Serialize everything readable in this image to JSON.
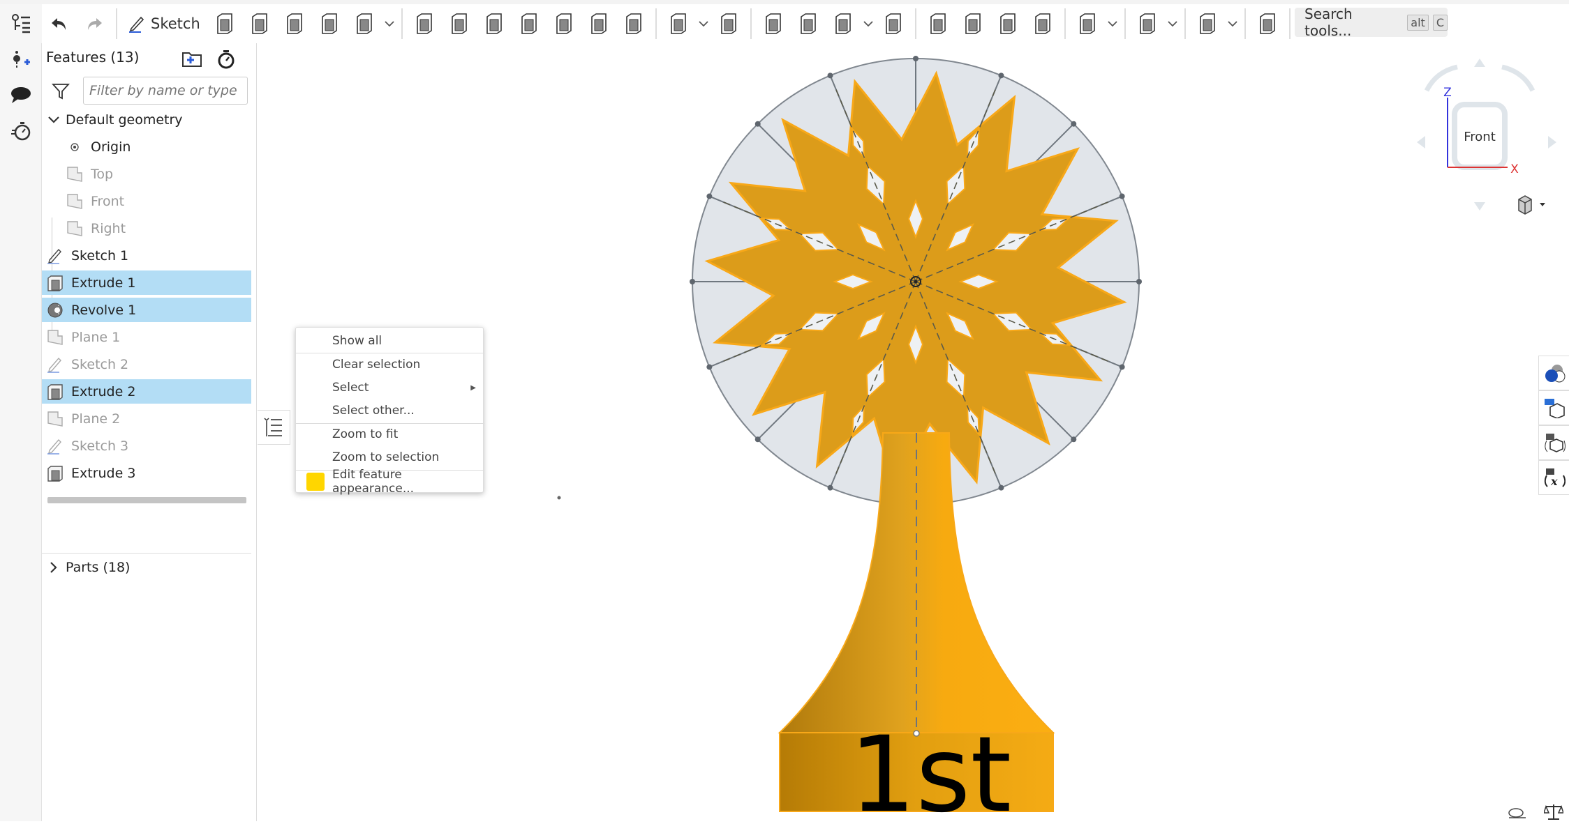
{
  "toolbar": {
    "sketch_label": "Sketch",
    "search_label": "Search tools...",
    "search_kbd": [
      "alt",
      "C"
    ],
    "groups": [
      [
        "extrude-icon",
        "revolve-icon",
        "sweep-icon",
        "loft-icon",
        "thicken-icon"
      ],
      [
        "fillet-icon",
        "chamfer-icon",
        "draft-icon",
        "rib-icon",
        "shell-icon",
        "hole-icon",
        "thread-icon"
      ],
      [
        "pattern-icon",
        "mirror-icon"
      ],
      [
        "boolean-icon",
        "split-icon",
        "transform-icon",
        "delete-part-icon"
      ],
      [
        "modify-fillet-icon",
        "delete-face-icon",
        "move-face-icon",
        "replace-face-icon"
      ],
      [
        "plane-icon"
      ],
      [
        "sheet-metal-icon"
      ],
      [
        "frame-icon"
      ],
      [
        "add-custom-feature-icon"
      ]
    ],
    "dropdown_after": [
      "thicken-icon",
      "pattern-icon",
      "transform-icon",
      "plane-icon",
      "sheet-metal-icon",
      "frame-icon"
    ]
  },
  "features": {
    "title": "Features (13)",
    "filter_placeholder": "Filter by name or type",
    "default_geometry": "Default geometry",
    "items": [
      {
        "label": "Origin",
        "icon": "origin-icon",
        "state": "normal",
        "child": true
      },
      {
        "label": "Top",
        "icon": "plane-icon",
        "state": "suppressed",
        "child": true
      },
      {
        "label": "Front",
        "icon": "plane-icon",
        "state": "suppressed",
        "child": true
      },
      {
        "label": "Right",
        "icon": "plane-icon",
        "state": "suppressed",
        "child": true
      },
      {
        "label": "Sketch 1",
        "icon": "sketch-icon",
        "state": "normal",
        "child": false
      },
      {
        "label": "Extrude 1",
        "icon": "extrude-icon",
        "state": "selected",
        "child": false
      },
      {
        "label": "Revolve 1",
        "icon": "revolve-icon",
        "state": "selected",
        "child": false
      },
      {
        "label": "Plane 1",
        "icon": "plane-icon",
        "state": "suppressed",
        "child": false
      },
      {
        "label": "Sketch 2",
        "icon": "sketch-icon",
        "state": "suppressed",
        "child": false
      },
      {
        "label": "Extrude 2",
        "icon": "extrude-icon",
        "state": "selected",
        "child": false
      },
      {
        "label": "Plane 2",
        "icon": "plane-icon",
        "state": "suppressed",
        "child": false
      },
      {
        "label": "Sketch 3",
        "icon": "sketch-icon",
        "state": "suppressed",
        "child": false
      },
      {
        "label": "Extrude 3",
        "icon": "extrude-icon",
        "state": "normal",
        "child": false
      }
    ],
    "parts_label": "Parts (18)"
  },
  "context_menu": {
    "items": [
      "Show all",
      "Clear selection",
      "Select",
      "Select other...",
      "Zoom to fit",
      "Zoom to selection",
      "Edit feature appearance..."
    ],
    "swatch_color": "#ffd600"
  },
  "viewport": {
    "base_text": "1st",
    "part_color": "#f5a814",
    "viewcube_label": "Front",
    "axis_z": "Z",
    "axis_x": "X"
  }
}
